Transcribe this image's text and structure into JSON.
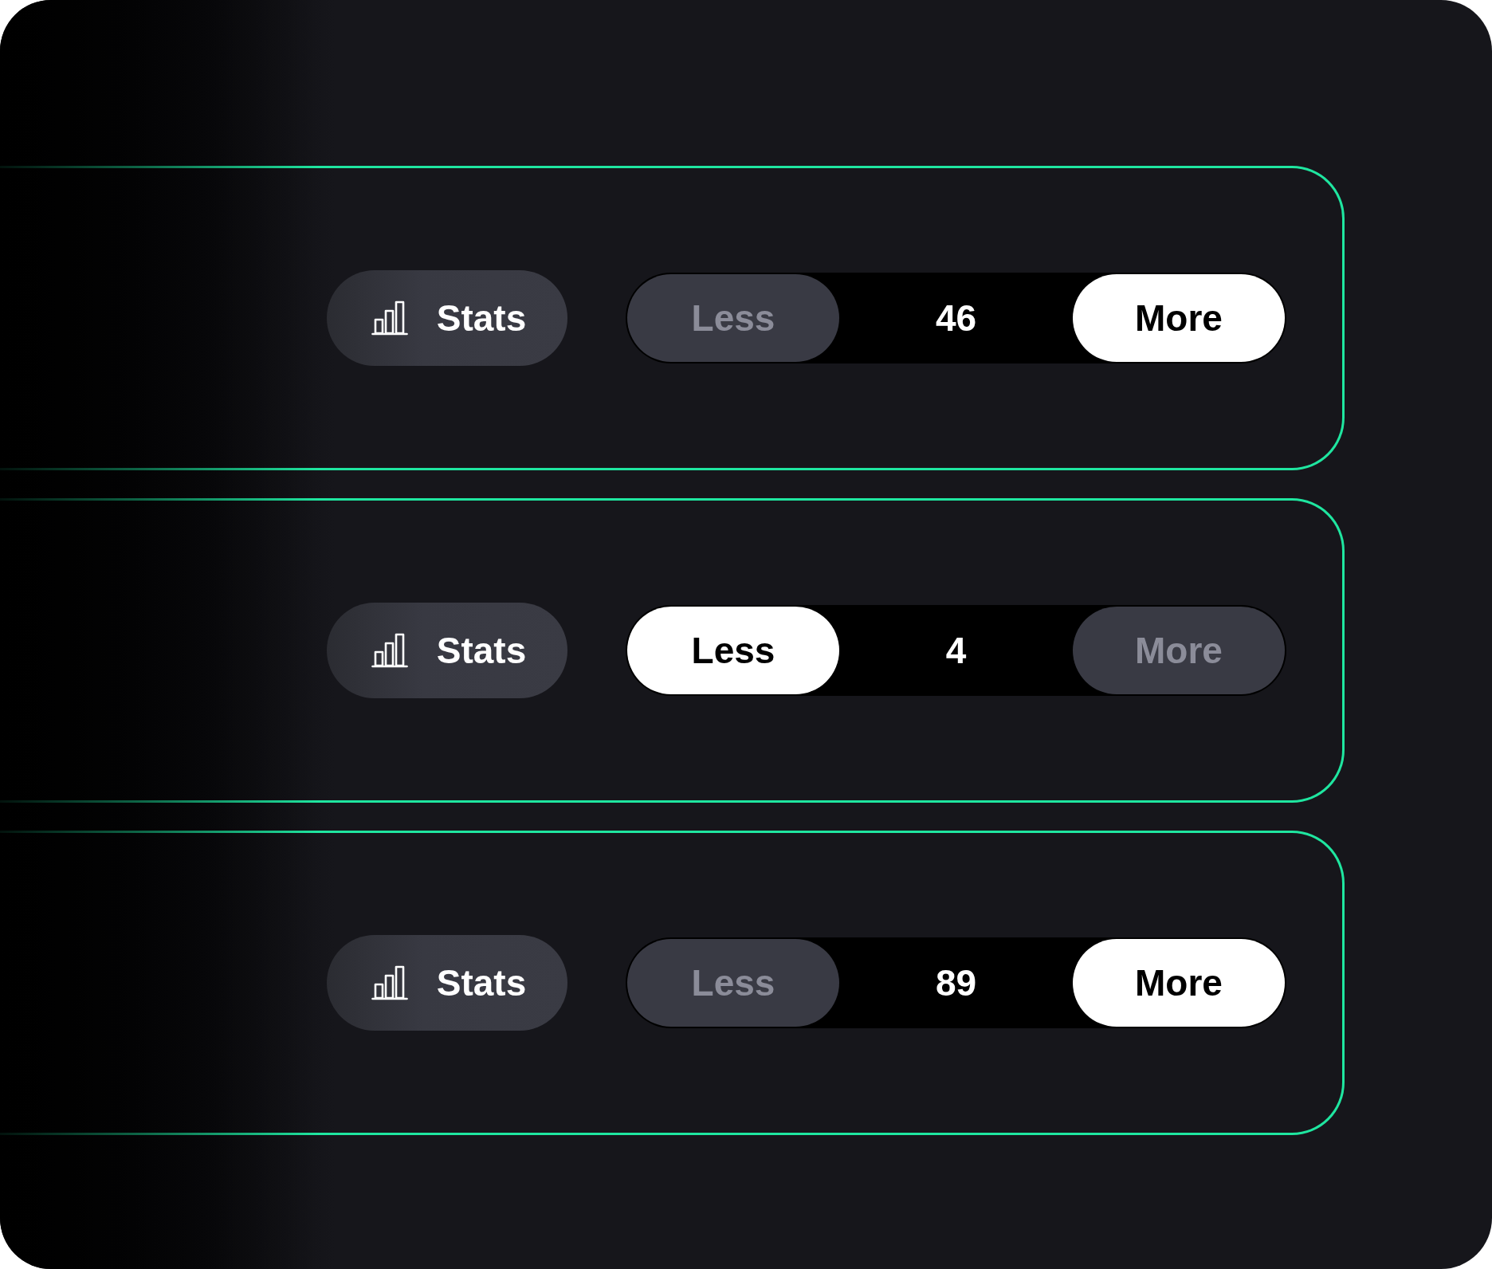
{
  "rows": [
    {
      "stats_label": "Stats",
      "decrease": {
        "label": "Less",
        "selected": false
      },
      "count": "46",
      "increase": {
        "label": "More",
        "selected": true
      }
    },
    {
      "stats_label": "Stats",
      "decrease": {
        "label": "Less",
        "selected": true
      },
      "count": "4",
      "increase": {
        "label": "More",
        "selected": false
      }
    },
    {
      "stats_label": "Stats",
      "decrease": {
        "label": "Less",
        "selected": false
      },
      "count": "89",
      "increase": {
        "label": "More",
        "selected": true
      }
    }
  ]
}
